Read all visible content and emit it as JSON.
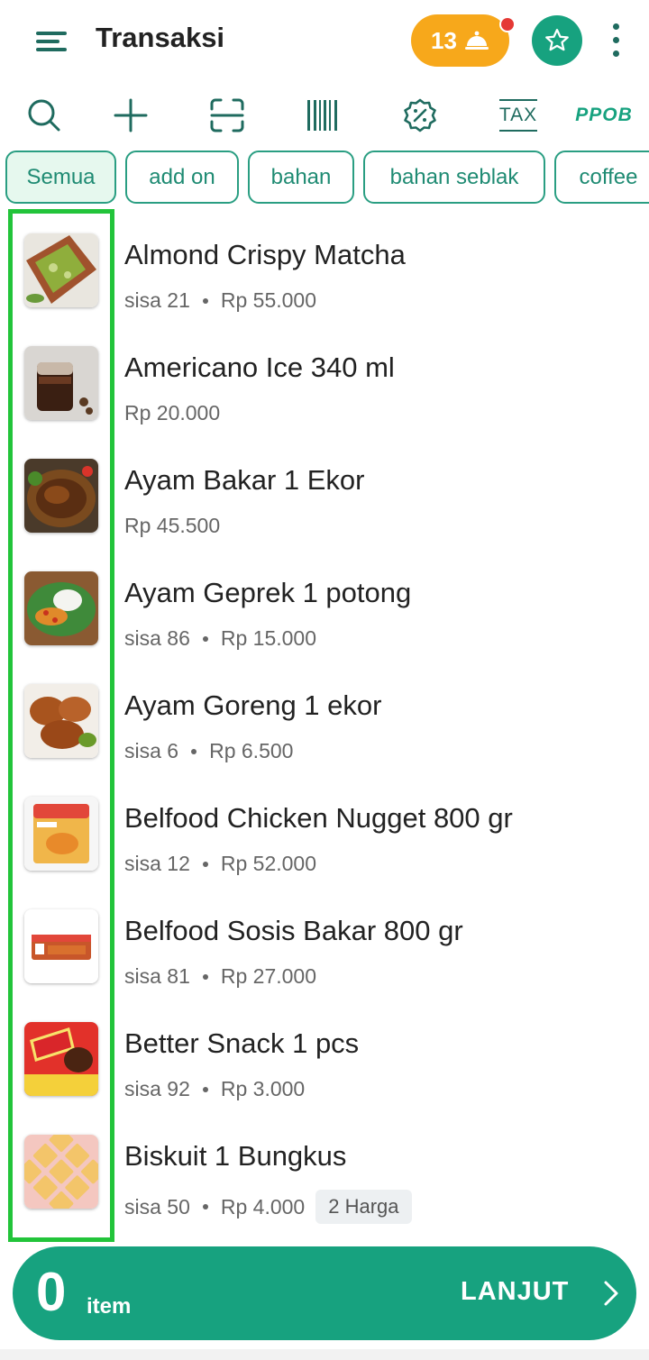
{
  "header": {
    "title": "Transaksi",
    "order_count": "13"
  },
  "toolbar": {
    "tax_label": "TAX",
    "ppob_label": "PPOB"
  },
  "categories": [
    "Semua",
    "add on",
    "bahan",
    "bahan seblak",
    "coffee"
  ],
  "products": [
    {
      "name": "Almond Crispy Matcha",
      "stock": "sisa 21",
      "price": "Rp 55.000"
    },
    {
      "name": "Americano Ice 340 ml",
      "stock": "",
      "price": "Rp 20.000"
    },
    {
      "name": "Ayam Bakar  1 Ekor",
      "stock": "",
      "price": "Rp 45.500"
    },
    {
      "name": "Ayam Geprek 1 potong",
      "stock": "sisa 86",
      "price": "Rp 15.000"
    },
    {
      "name": "Ayam Goreng 1 ekor",
      "stock": "sisa 6",
      "price": "Rp 6.500"
    },
    {
      "name": "Belfood Chicken Nugget 800 gr",
      "stock": "sisa 12",
      "price": "Rp 52.000"
    },
    {
      "name": "Belfood Sosis Bakar 800 gr",
      "stock": "sisa 81",
      "price": "Rp 27.000"
    },
    {
      "name": "Better Snack 1 pcs",
      "stock": "sisa 92",
      "price": "Rp 3.000"
    },
    {
      "name": "Biskuit 1 Bungkus",
      "stock": "sisa 50",
      "price": "Rp 4.000",
      "tag": "2 Harga"
    }
  ],
  "cart": {
    "count": "0",
    "unit": "item",
    "action_label": "LANJUT"
  },
  "colors": {
    "primary": "#17a27f",
    "accent_orange": "#f7a81b",
    "highlight_green": "#22c43a",
    "dark_green": "#1f6b5f"
  }
}
